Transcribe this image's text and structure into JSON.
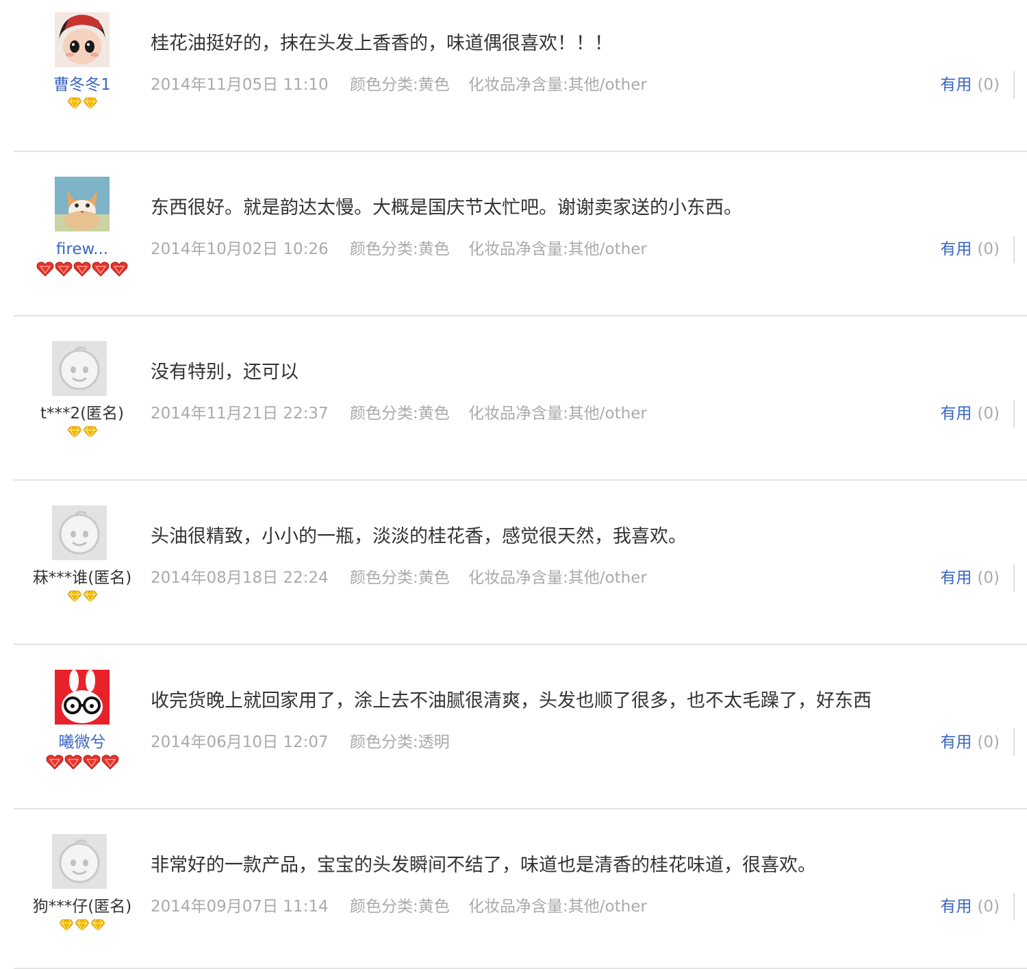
{
  "useful_label": "有用",
  "reviews": [
    {
      "user": "曹冬冬1",
      "user_avatar_icon": "doll-avatar-icon",
      "level_icon": "yellow-diamond-icon",
      "level_count": 2,
      "text": "桂花油挺好的，抹在头发上香香的，味道偶很喜欢！！！",
      "date": "2014年11月05日 11:10",
      "color_category": "颜色分类:黄色",
      "net_content": "化妆品净含量:其他/other",
      "useful_count": "(0)"
    },
    {
      "user": "firew...",
      "user_avatar_icon": "cat-avatar-icon",
      "level_icon": "red-heart-icon",
      "level_count": 5,
      "text": "东西很好。就是韵达太慢。大概是国庆节太忙吧。谢谢卖家送的小东西。",
      "date": "2014年10月02日 10:26",
      "color_category": "颜色分类:黄色",
      "net_content": "化妆品净含量:其他/other",
      "useful_count": "(0)"
    },
    {
      "user": "t***2(匿名)",
      "user_avatar_icon": "default-avatar-icon",
      "level_icon": "yellow-diamond-icon",
      "level_count": 2,
      "text": "没有特别，还可以",
      "date": "2014年11月21日 22:37",
      "color_category": "颜色分类:黄色",
      "net_content": "化妆品净含量:其他/other",
      "useful_count": "(0)"
    },
    {
      "user": "菻***谁(匿名)",
      "user_avatar_icon": "default-avatar-icon",
      "level_icon": "yellow-diamond-icon",
      "level_count": 2,
      "text": "头油很精致，小小的一瓶，淡淡的桂花香，感觉很天然，我喜欢。",
      "date": "2014年08月18日 22:24",
      "color_category": "颜色分类:黄色",
      "net_content": "化妆品净含量:其他/other",
      "useful_count": "(0)"
    },
    {
      "user": "曦微兮",
      "user_avatar_icon": "bunny-glasses-avatar-icon",
      "level_icon": "red-heart-icon",
      "level_count": 4,
      "text": "收完货晚上就回家用了，涂上去不油腻很清爽，头发也顺了很多，也不太毛躁了，好东西",
      "date": "2014年06月10日 12:07",
      "color_category": "颜色分类:透明",
      "net_content": "",
      "useful_count": "(0)"
    },
    {
      "user": "狗***仔(匿名)",
      "user_avatar_icon": "default-avatar-icon",
      "level_icon": "yellow-diamond-icon",
      "level_count": 3,
      "text": "非常好的一款产品，宝宝的头发瞬间不结了，味道也是清香的桂花味道，很喜欢。",
      "date": "2014年09月07日 11:14",
      "color_category": "颜色分类:黄色",
      "net_content": "化妆品净含量:其他/other",
      "useful_count": "(0)"
    }
  ],
  "colors": {
    "link_blue": "#3a66c4",
    "meta_gray": "#aaaaaa",
    "text_dark": "#333333",
    "diamond_yellow": "#f5b800",
    "heart_red": "#e8332a"
  }
}
